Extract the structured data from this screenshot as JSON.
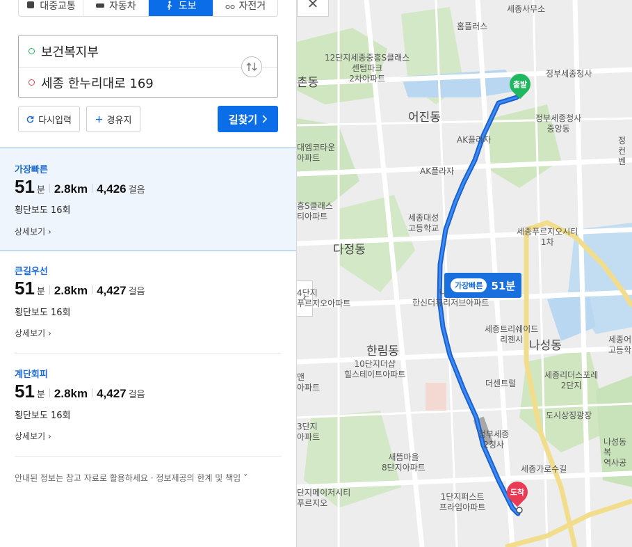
{
  "modes": [
    {
      "label": "대중교통",
      "icon": "bus-icon"
    },
    {
      "label": "자동차",
      "icon": "car-icon"
    },
    {
      "label": "도보",
      "icon": "walk-icon"
    },
    {
      "label": "자전거",
      "icon": "bike-icon"
    }
  ],
  "route": {
    "start": "보건복지부",
    "end": "세종 한누리대로 169"
  },
  "buttons": {
    "reset": "다시입력",
    "waypoint": "경유지",
    "search": "길찾기"
  },
  "results": [
    {
      "label": "가장빠른",
      "minutes": "51",
      "minutes_unit": "분",
      "distance": "2.8km",
      "steps": "4,426",
      "steps_unit": "걸음",
      "crosswalk": "횡단보도 16회",
      "detail": "상세보기"
    },
    {
      "label": "큰길우선",
      "minutes": "51",
      "minutes_unit": "분",
      "distance": "2.8km",
      "steps": "4,427",
      "steps_unit": "걸음",
      "crosswalk": "횡단보도 16회",
      "detail": "상세보기"
    },
    {
      "label": "계단회피",
      "minutes": "51",
      "minutes_unit": "분",
      "distance": "2.8km",
      "steps": "4,427",
      "steps_unit": "걸음",
      "crosswalk": "횡단보도 16회",
      "detail": "상세보기"
    }
  ],
  "notice": {
    "text": "안내된 정보는 참고 자료로 활용하세요",
    "link": "정보제공의 한계 및 책임"
  },
  "map": {
    "bubble_tag": "가장빠른",
    "bubble_time": "51분",
    "start_pin": "출발",
    "end_pin": "도착",
    "labels": {
      "sejong_office": "세종사무소",
      "homeplus": "홈플러스",
      "apt12": "12단지세종중흥S클래스\n센텀파크\n2차아파트",
      "chondong": "촌동",
      "gov_complex": "정부세종청사",
      "eojindong": "어진동",
      "gov_central": "정부세종청사\n중앙동",
      "ak1": "AK플라자",
      "ak2": "AK플라자",
      "daemyung": "대엠코타운\n아파트",
      "heungs": "흥S클래스\n티아파트",
      "sejong_hs": "세종대성\n고등학교",
      "puru1": "세종푸르지오시티\n1차",
      "dajeong": "다정동",
      "apt4": "4단지\n푸르지오아파트",
      "naseong_apt": "나릿재\n한신더휴리저브아파트",
      "trishade": "세종트리쉐이드\n리젠시",
      "naseong": "나성동",
      "sejong_right": "세종어\n고등학",
      "hallim": "한림동",
      "hill10": "10단지더샵\n힐스테이트아파트",
      "center": "더센트럴",
      "forest": "세종리더스포레\n2단지",
      "park": "도시상징광장",
      "apt_left": "앤\n아파트",
      "apt3": "3단지\n아파트",
      "gov2": "정부세종\n2청사",
      "newmoon": "새뜸마을\n8단지아파트",
      "naseong_station": "나성동복\n역사공",
      "street": "세종가로수길",
      "major": "단지메이저시티\n푸르지오",
      "first": "1단지퍼스트\n프라임아파트",
      "jeongcom": "정\n컨벤"
    }
  }
}
